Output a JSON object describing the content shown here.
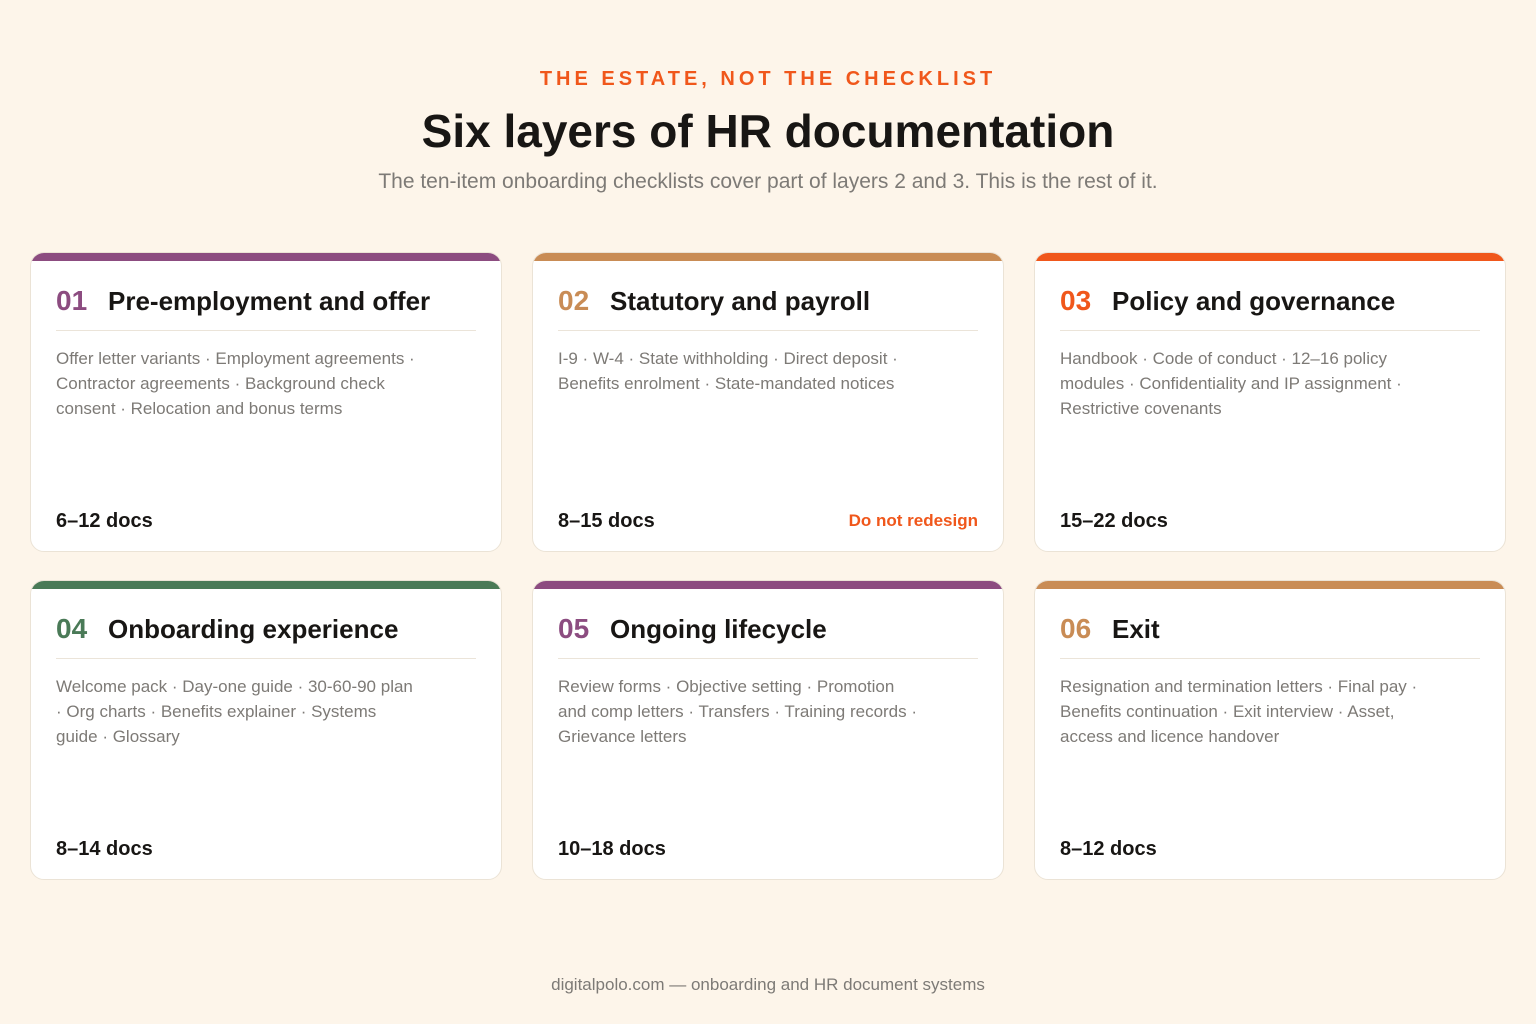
{
  "header": {
    "eyebrow": "THE ESTATE, NOT THE CHECKLIST",
    "title": "Six layers of HR documentation",
    "subtitle": "The ten-item onboarding checklists cover part of layers 2 and 3. This is the rest of it."
  },
  "colors": {
    "purple": "#8c4c80",
    "tan": "#c98c55",
    "orange": "#f0571b",
    "green": "#4a7a57"
  },
  "layers": [
    {
      "number": "01",
      "title": "Pre-employment and offer",
      "items": "Offer letter variants · Employment agreements · Contractor agreements · Background check consent · Relocation and bonus terms",
      "count": "6–12 docs",
      "flag": "",
      "accent": "#8c4c80"
    },
    {
      "number": "02",
      "title": "Statutory and payroll",
      "items": "I-9 · W-4 · State withholding · Direct deposit · Benefits enrolment · State-mandated notices",
      "count": "8–15 docs",
      "flag": "Do not redesign",
      "accent": "#c98c55"
    },
    {
      "number": "03",
      "title": "Policy and governance",
      "items": "Handbook · Code of conduct · 12–16 policy modules · Confidentiality and IP assignment · Restrictive covenants",
      "count": "15–22 docs",
      "flag": "",
      "accent": "#f0571b"
    },
    {
      "number": "04",
      "title": "Onboarding experience",
      "items": "Welcome pack · Day-one guide · 30-60-90 plan · Org charts · Benefits explainer · Systems guide · Glossary",
      "count": "8–14 docs",
      "flag": "",
      "accent": "#4a7a57"
    },
    {
      "number": "05",
      "title": "Ongoing lifecycle",
      "items": "Review forms · Objective setting · Promotion and comp letters · Transfers · Training records · Grievance letters",
      "count": "10–18 docs",
      "flag": "",
      "accent": "#8c4c80"
    },
    {
      "number": "06",
      "title": "Exit",
      "items": "Resignation and termination letters · Final pay · Benefits continuation · Exit interview · Asset, access and licence handover",
      "count": "8–12 docs",
      "flag": "",
      "accent": "#c98c55"
    }
  ],
  "footer": {
    "text": "digitalpolo.com — onboarding and HR document systems"
  }
}
